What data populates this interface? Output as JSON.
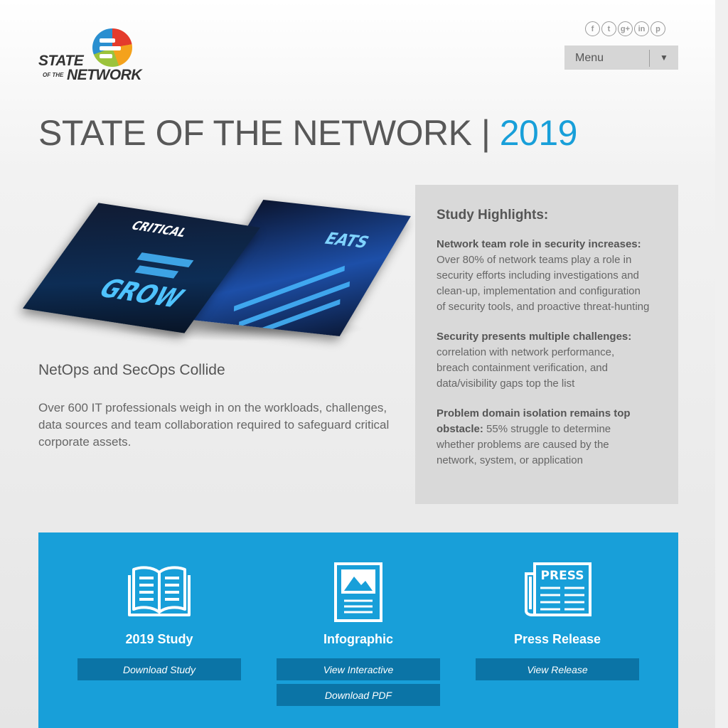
{
  "logo": {
    "line1": "STATE",
    "line2": "OF THE",
    "line3": "NETWORK"
  },
  "social": [
    {
      "name": "facebook-icon",
      "glyph": "f"
    },
    {
      "name": "twitter-icon",
      "glyph": "t"
    },
    {
      "name": "google-plus-icon",
      "glyph": "g+"
    },
    {
      "name": "linkedin-icon",
      "glyph": "in"
    },
    {
      "name": "pinterest-icon",
      "glyph": "p"
    }
  ],
  "menu": {
    "label": "Menu",
    "caret": "▼"
  },
  "title": {
    "main": "STATE OF THE NETWORK |",
    "year": "2019"
  },
  "hero": {
    "front_word": "GROW",
    "front_top": "CRITICAL",
    "back_word": "EATS"
  },
  "subhead": "NetOps and SecOps Collide",
  "intro": "Over 600 IT professionals weigh in on the workloads, challenges, data sources and team collaboration required to safeguard critical corporate assets.",
  "highlights": {
    "title": "Study Highlights:",
    "items": [
      {
        "heading": "Network team role in security increases:",
        "text": " Over 80% of network teams play a role in security efforts including investigations and clean-up, implementation and configuration of security tools, and proactive threat-hunting"
      },
      {
        "heading": "Security presents multiple challenges:",
        "text": " correlation with network performance, breach containment verification, and data/visibility gaps top the list"
      },
      {
        "heading": "Problem domain isolation remains top obstacle:",
        "text": " 55% struggle to determine whether problems are caused by the network, system, or application"
      }
    ]
  },
  "cta": [
    {
      "label": "2019 Study",
      "buttons": [
        "Download Study"
      ],
      "icon": "open-book-icon"
    },
    {
      "label": "Infographic",
      "buttons": [
        "View Interactive",
        "Download PDF"
      ],
      "icon": "document-image-icon"
    },
    {
      "label": "Press Release",
      "buttons": [
        "View Release"
      ],
      "icon": "newspaper-icon",
      "icon_text": "PRESS"
    }
  ],
  "colors": {
    "accent": "#189fd9",
    "button": "#0b74a6",
    "panel": "#d9d9d9",
    "title": "#585858"
  }
}
